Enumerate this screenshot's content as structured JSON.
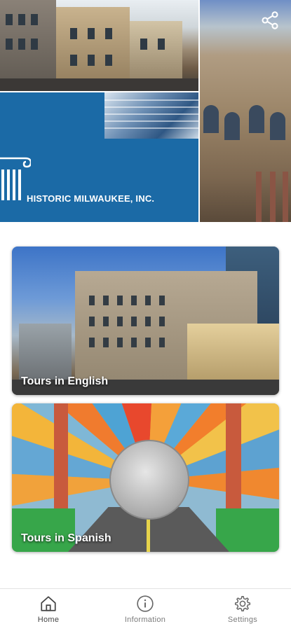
{
  "header": {
    "organization_name": "HISTORIC MILWAUKEE, INC.",
    "share_icon": "share-icon",
    "brand_blue": "#1b6aa6"
  },
  "tours": [
    {
      "label": "Tours in English"
    },
    {
      "label": "Tours in Spanish"
    }
  ],
  "bottom_nav": {
    "items": [
      {
        "label": "Home",
        "icon": "home-icon",
        "active": true
      },
      {
        "label": "Information",
        "icon": "info-icon",
        "active": false
      },
      {
        "label": "Settings",
        "icon": "gear-icon",
        "active": false
      }
    ]
  }
}
